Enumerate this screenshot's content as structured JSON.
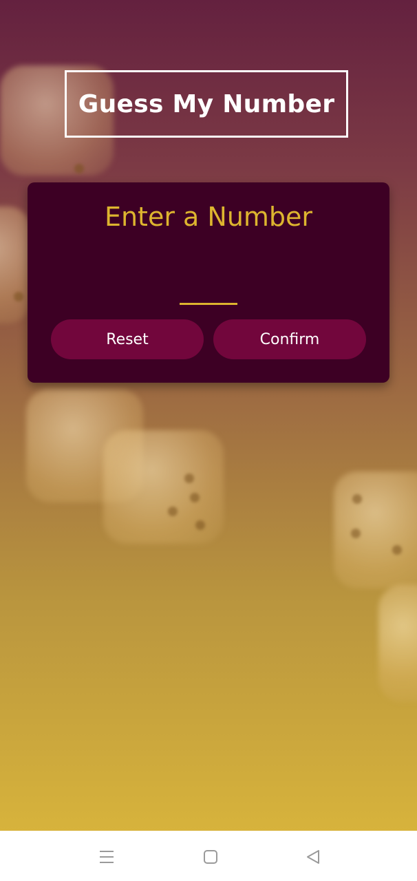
{
  "app": {
    "title": "Guess My Number"
  },
  "card": {
    "title": "Enter a Number",
    "input_value": "",
    "input_placeholder": ""
  },
  "buttons": {
    "reset_label": "Reset",
    "confirm_label": "Confirm"
  },
  "colors": {
    "accent": "#ddb52f",
    "card_background": "#3d0024",
    "button_background": "#72063c",
    "title_border": "#ffffff"
  },
  "navbar": {
    "items": [
      {
        "icon": "menu-icon"
      },
      {
        "icon": "home-square-icon"
      },
      {
        "icon": "back-triangle-icon"
      }
    ]
  }
}
